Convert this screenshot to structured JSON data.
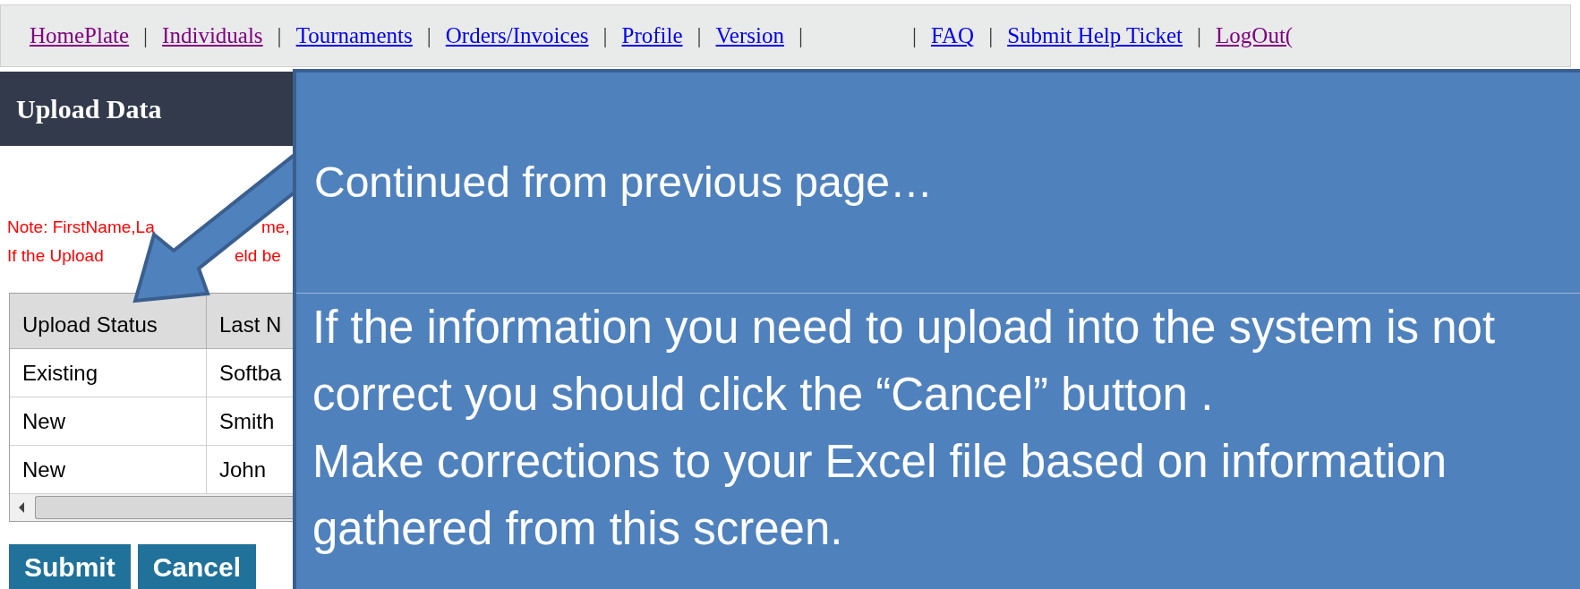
{
  "nav": [
    {
      "kind": "link",
      "label": "HomePlate",
      "visited": true
    },
    {
      "kind": "separator",
      "label": "|"
    },
    {
      "kind": "link",
      "label": "Individuals",
      "visited": true
    },
    {
      "kind": "separator",
      "label": "|"
    },
    {
      "kind": "link",
      "label": "Tournaments",
      "visited": false
    },
    {
      "kind": "separator",
      "label": "|"
    },
    {
      "kind": "link",
      "label": "Orders/Invoices",
      "visited": false
    },
    {
      "kind": "separator",
      "label": "|"
    },
    {
      "kind": "link",
      "label": "Profile",
      "visited": false
    },
    {
      "kind": "separator",
      "label": "|"
    },
    {
      "kind": "link",
      "label": "Version",
      "visited": false
    },
    {
      "kind": "separator",
      "label": "|"
    },
    {
      "kind": "gap"
    },
    {
      "kind": "separator",
      "label": "|"
    },
    {
      "kind": "link",
      "label": "FAQ",
      "visited": false
    },
    {
      "kind": "separator",
      "label": "|"
    },
    {
      "kind": "link",
      "label": "Submit Help Ticket",
      "visited": false
    },
    {
      "kind": "separator",
      "label": "|"
    },
    {
      "kind": "link",
      "label": "LogOut(",
      "visited": true
    }
  ],
  "header": {
    "title": "Upload Data"
  },
  "notes": [
    [
      "Note: FirstName,La",
      "me,"
    ],
    [
      "If the Upload",
      "eld be"
    ]
  ],
  "table": {
    "columns": [
      "Upload Status",
      "Last N"
    ],
    "rows": [
      [
        "Existing",
        "Softba"
      ],
      [
        "New",
        "Smith"
      ],
      [
        "New",
        "John"
      ]
    ]
  },
  "buttons": [
    "Submit",
    "Cancel"
  ],
  "callout": {
    "title": "Continued from previous page…",
    "body": [
      "If the information you need to upload into the system is not correct you should click the “Cancel” button .",
      "Make corrections to your Excel file based on information gathered from this screen."
    ]
  }
}
